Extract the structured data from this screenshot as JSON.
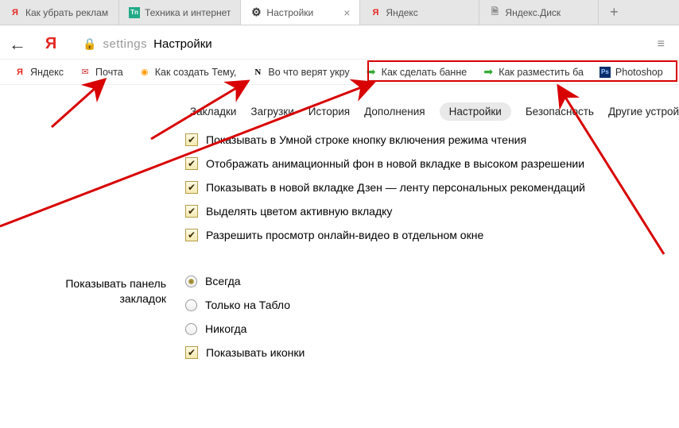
{
  "tabs": [
    {
      "label": "Как убрать реклам",
      "icon": "y"
    },
    {
      "label": "Техника и интернет",
      "icon": "tn"
    },
    {
      "label": "Настройки",
      "icon": "gear",
      "active": true,
      "closeable": true
    },
    {
      "label": "Яндекс",
      "icon": "y"
    },
    {
      "label": "Яндекс.Диск",
      "icon": "page"
    }
  ],
  "newtab_glyph": "+",
  "back_glyph": "←",
  "ylogo_glyph": "Я",
  "addr": {
    "lock": "🔒",
    "keyword": "settings",
    "title": "Настройки"
  },
  "more_glyph": "≡",
  "bookmarks": [
    {
      "label": "Яндекс",
      "icon": "y"
    },
    {
      "label": "Почта",
      "icon": "mail"
    },
    {
      "label": "Как создать Тему,",
      "icon": "orange"
    },
    {
      "label": "Во что верят укру",
      "icon": "n"
    },
    {
      "label": "Как сделать банне",
      "icon": "green"
    },
    {
      "label": "Как разместить ба",
      "icon": "green"
    },
    {
      "label": "Photoshop",
      "icon": "ps"
    }
  ],
  "subnav": [
    {
      "label": "Закладки"
    },
    {
      "label": "Загрузки"
    },
    {
      "label": "История"
    },
    {
      "label": "Дополнения"
    },
    {
      "label": "Настройки",
      "active": true
    },
    {
      "label": "Безопасность"
    },
    {
      "label": "Другие устрой"
    }
  ],
  "settings_group1": [
    "Показывать в Умной строке кнопку включения режима чтения",
    "Отображать анимационный фон в новой вкладке в высоком разрешении",
    "Показывать в новой вкладке Дзен — ленту персональных рекомендаций",
    "Выделять цветом активную вкладку",
    "Разрешить просмотр онлайн-видео в отдельном окне"
  ],
  "bookmarks_panel": {
    "title_l1": "Показывать панель",
    "title_l2": "закладок",
    "radios": [
      {
        "label": "Всегда",
        "selected": true
      },
      {
        "label": "Только на Табло",
        "selected": false
      },
      {
        "label": "Никогда",
        "selected": false
      }
    ],
    "show_icons": "Показывать иконки"
  },
  "check_glyph": "✔"
}
